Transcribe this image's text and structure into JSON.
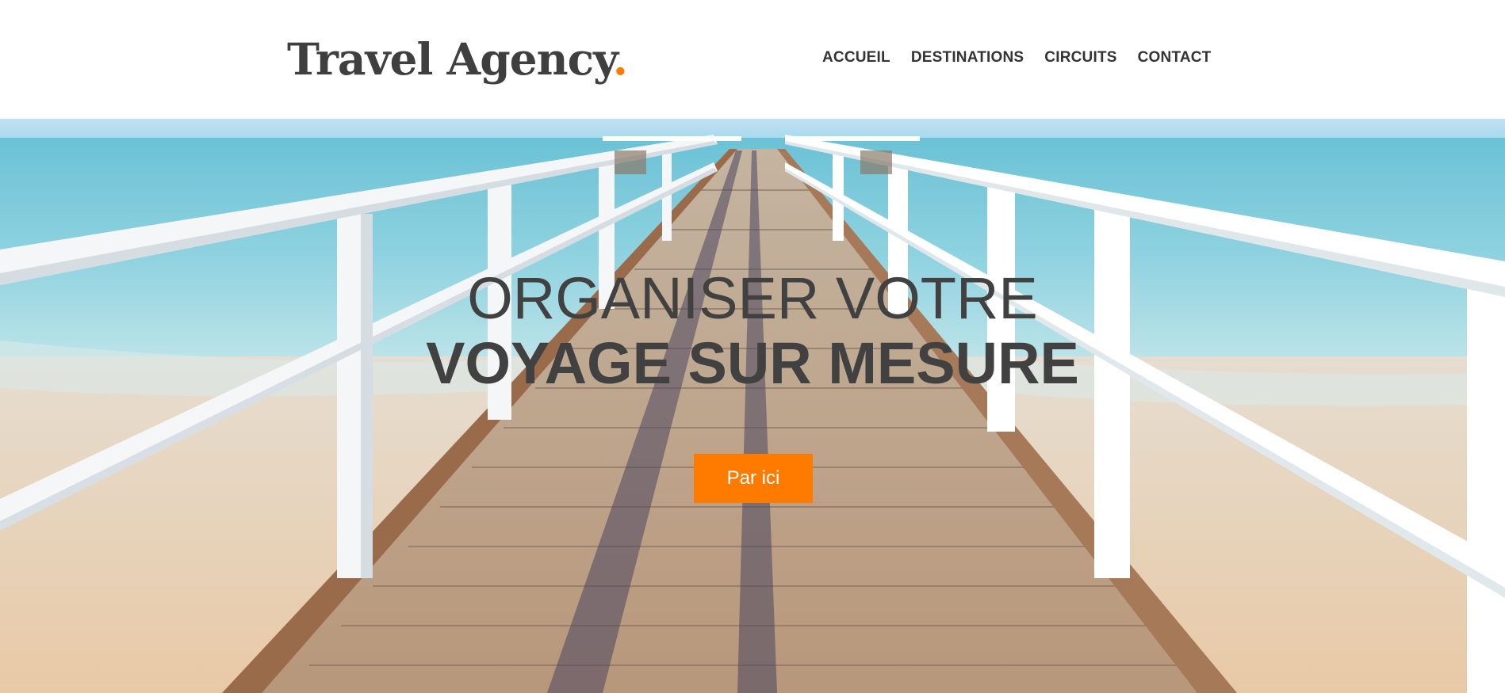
{
  "brand": {
    "name": "Travel Agency",
    "dot": ".",
    "accent": "#ff7b00"
  },
  "nav": {
    "items": [
      {
        "label": "ACCUEIL"
      },
      {
        "label": "DESTINATIONS"
      },
      {
        "label": "CIRCUITS"
      },
      {
        "label": "CONTACT"
      }
    ]
  },
  "hero": {
    "title_line1": "ORGANISER VOTRE",
    "title_line2": "VOYAGE SUR MESURE",
    "cta_label": "Par ici",
    "image": "pier-over-ocean"
  }
}
